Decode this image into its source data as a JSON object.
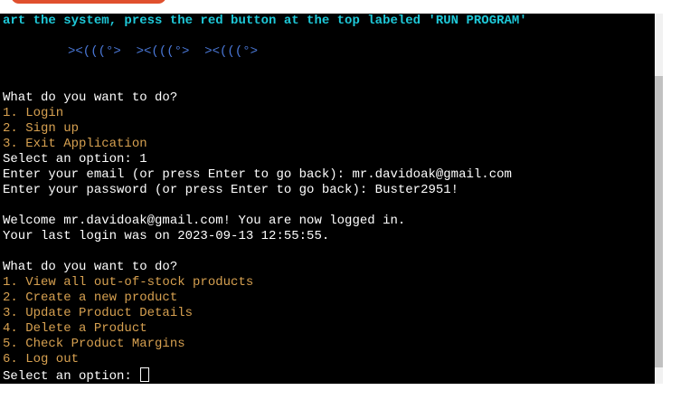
{
  "run_button": {
    "label": ""
  },
  "terminal": {
    "banner": "art the system, press the red button at the top labeled 'RUN PROGRAM'",
    "fish": "><(((°>  ><(((°>  ><(((°>",
    "prompt_1": "What do you want to do?",
    "menu_1": [
      "1. Login",
      "2. Sign up",
      "3. Exit Application"
    ],
    "select_1": "Select an option: 1",
    "email_line": "Enter your email (or press Enter to go back): mr.davidoak@gmail.com",
    "password_line": "Enter your password (or press Enter to go back): Buster2951!",
    "welcome_line": "Welcome mr.davidoak@gmail.com! You are now logged in.",
    "last_login_line": "Your last login was on 2023-09-13 12:55:55.",
    "prompt_2": "What do you want to do?",
    "menu_2": [
      "1. View all out-of-stock products",
      "2. Create a new product",
      "3. Update Product Details",
      "4. Delete a Product",
      "5. Check Product Margins",
      "6. Log out"
    ],
    "select_2": "Select an option: "
  },
  "colors": {
    "background": "#000000",
    "text": "#ffffff",
    "banner": "#1ec8d8",
    "fish": "#4a78d8",
    "menu": "#d6a050",
    "run_button": "#e0502e"
  }
}
